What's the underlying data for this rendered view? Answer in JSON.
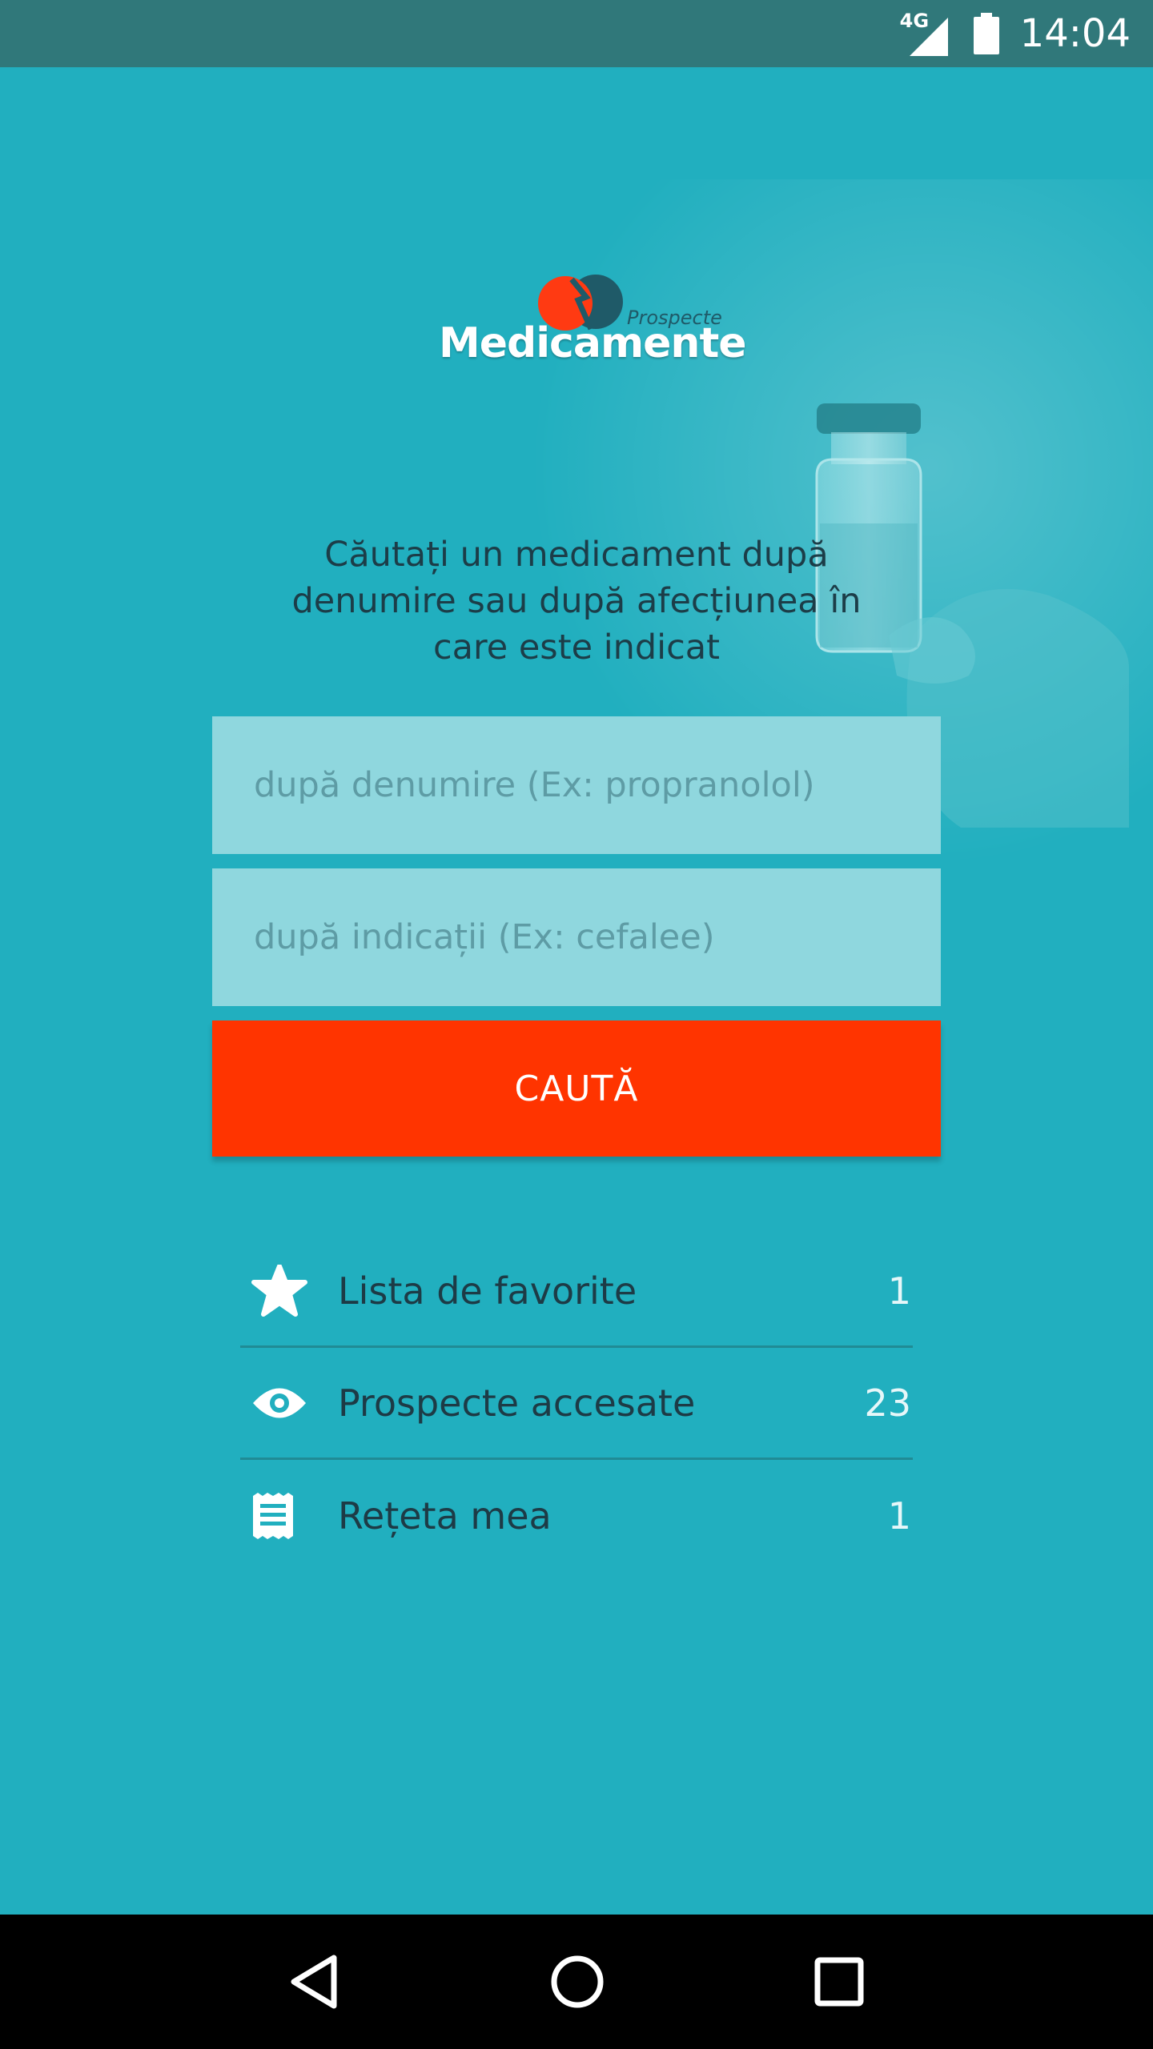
{
  "status_bar": {
    "network": "4G",
    "time": "14:04"
  },
  "logo": {
    "prospecte": "Prospecte",
    "medicamente": "Medicamente"
  },
  "intro_text": "Căutați un medicament după denumire sau după afecțiunea în care este indicat",
  "search": {
    "name_placeholder": "după denumire (Ex: propranolol)",
    "indication_placeholder": "după indicații (Ex: cefalee)",
    "button_label": "CAUTĂ"
  },
  "menu": {
    "items": [
      {
        "label": "Lista de favorite",
        "count": "1",
        "icon": "star-icon"
      },
      {
        "label": "Prospecte accesate",
        "count": "23",
        "icon": "eye-icon"
      },
      {
        "label": "Rețeta mea",
        "count": "1",
        "icon": "receipt-icon"
      }
    ]
  },
  "colors": {
    "background": "#21afbf",
    "status_bar": "#30787a",
    "accent": "#ff3400",
    "field": "#8fd7de"
  }
}
